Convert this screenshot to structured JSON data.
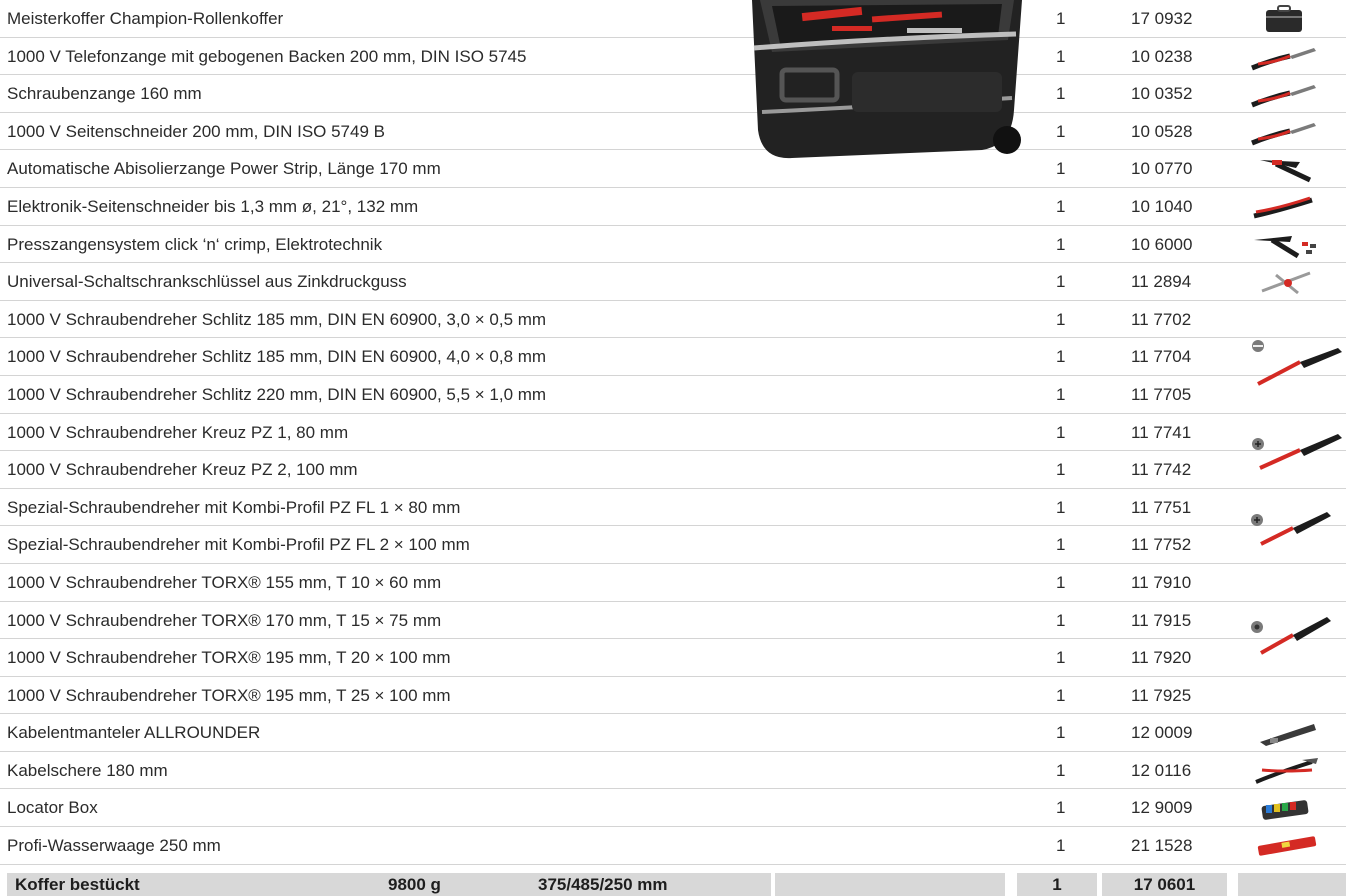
{
  "rows": [
    {
      "name": "Meisterkoffer Champion-Rollenkoffer",
      "qty": "1",
      "art": "17 0932",
      "icon": "case-icon"
    },
    {
      "name": "1000 V Telefonzange mit gebogenen Backen 200 mm, DIN ISO 5745",
      "qty": "1",
      "art": "10 0238",
      "icon": "pliers-icon"
    },
    {
      "name": "Schraubenzange 160 mm",
      "qty": "1",
      "art": "10 0352",
      "icon": "pliers-icon"
    },
    {
      "name": "1000 V Seitenschneider 200 mm, DIN ISO 5749 B",
      "qty": "1",
      "art": "10 0528",
      "icon": "pliers-icon"
    },
    {
      "name": "Automatische Abisolierzange Power Strip, Länge 170 mm",
      "qty": "1",
      "art": "10 0770",
      "icon": "stripper-icon"
    },
    {
      "name": "Elektronik-Seitenschneider bis 1,3 mm ø, 21°, 132 mm",
      "qty": "1",
      "art": "10 1040",
      "icon": "cutter-icon"
    },
    {
      "name": "Presszangensystem click ‘n‘ crimp, Elektrotechnik",
      "qty": "1",
      "art": "10 6000",
      "icon": "crimp-icon"
    },
    {
      "name": "Universal-Schaltschrankschlüssel aus Zinkdruckguss",
      "qty": "1",
      "art": "11 2894",
      "icon": "key-icon"
    },
    {
      "name": "1000 V Schraubendreher Schlitz 185 mm, DIN EN 60900, 3,0 × 0,5 mm",
      "qty": "1",
      "art": "11 7702",
      "icon": ""
    },
    {
      "name": "1000 V Schraubendreher Schlitz 185 mm, DIN EN 60900, 4,0 × 0,8 mm",
      "qty": "1",
      "art": "11 7704",
      "icon": ""
    },
    {
      "name": "1000 V Schraubendreher Schlitz 220 mm, DIN EN 60900, 5,5 × 1,0 mm",
      "qty": "1",
      "art": "11 7705",
      "icon": ""
    },
    {
      "name": "1000 V Schraubendreher Kreuz PZ 1, 80 mm",
      "qty": "1",
      "art": "11 7741",
      "icon": ""
    },
    {
      "name": "1000 V Schraubendreher Kreuz PZ 2, 100 mm",
      "qty": "1",
      "art": "11 7742",
      "icon": ""
    },
    {
      "name": "Spezial-Schraubendreher mit Kombi-Profil PZ FL 1 × 80 mm",
      "qty": "1",
      "art": "11 7751",
      "icon": ""
    },
    {
      "name": "Spezial-Schraubendreher mit Kombi-Profil PZ FL 2 × 100 mm",
      "qty": "1",
      "art": "11 7752",
      "icon": ""
    },
    {
      "name": "1000 V Schraubendreher TORX® 155 mm, T 10 × 60 mm",
      "qty": "1",
      "art": "11 7910",
      "icon": ""
    },
    {
      "name": "1000 V Schraubendreher TORX® 170 mm, T 15 × 75 mm",
      "qty": "1",
      "art": "11 7915",
      "icon": ""
    },
    {
      "name": "1000 V Schraubendreher TORX® 195 mm, T 20 × 100 mm",
      "qty": "1",
      "art": "11 7920",
      "icon": ""
    },
    {
      "name": "1000 V Schraubendreher TORX® 195 mm, T 25 × 100 mm",
      "qty": "1",
      "art": "11 7925",
      "icon": ""
    },
    {
      "name": "Kabelentmanteler ALLROUNDER",
      "qty": "1",
      "art": "12 0009",
      "icon": "stripper-knife-icon"
    },
    {
      "name": "Kabelschere 180 mm",
      "qty": "1",
      "art": "12 0116",
      "icon": "cable-shears-icon"
    },
    {
      "name": "Locator Box",
      "qty": "1",
      "art": "12 9009",
      "icon": "locator-box-icon"
    },
    {
      "name": "Profi-Wasserwaage 250 mm",
      "qty": "1",
      "art": "21 1528",
      "icon": "spirit-level-icon"
    }
  ],
  "footer": {
    "label": "Koffer bestückt",
    "weight": "9800 g",
    "dimensions": "375/485/250 mm",
    "qty": "1",
    "art": "17 0601"
  },
  "group_icons": [
    "slotted-screwdriver-icon",
    "phillips-screwdriver-icon",
    "combi-screwdriver-icon",
    "torx-screwdriver-icon"
  ],
  "colors": {
    "row_line": "#d4d4d4",
    "footer_bg": "#d8d8d8",
    "accent_red": "#d42a24"
  }
}
